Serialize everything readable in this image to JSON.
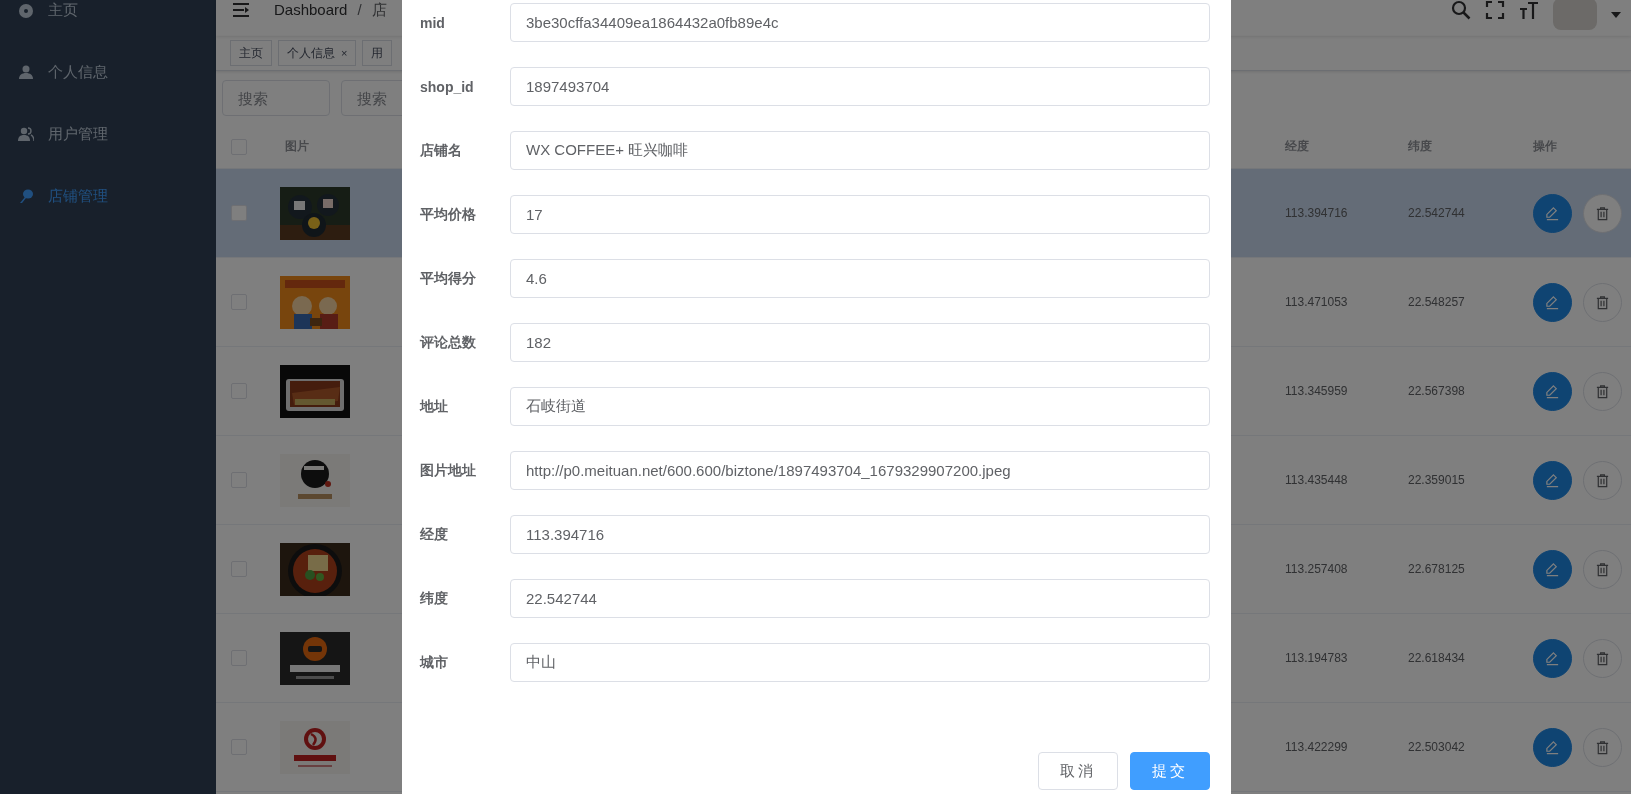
{
  "sidebar": {
    "items": [
      {
        "label": "主页",
        "selected": false
      },
      {
        "label": "个人信息",
        "selected": false
      },
      {
        "label": "用户管理",
        "selected": false
      },
      {
        "label": "店铺管理",
        "selected": true
      }
    ]
  },
  "navbar": {
    "breadcrumb": [
      "Dashboard",
      "/",
      "店"
    ]
  },
  "tags": [
    {
      "label": "主页"
    },
    {
      "label": "个人信息",
      "close": "×"
    },
    {
      "label": "用"
    }
  ],
  "search": [
    {
      "placeholder": "搜索"
    },
    {
      "placeholder": "搜索"
    }
  ],
  "table": {
    "all_checked": false,
    "columns": [
      "图片",
      "经度",
      "纬度",
      "操作"
    ],
    "rows": [
      {
        "selected": true,
        "checked": false,
        "longitude": "113.394716",
        "latitude": "22.542744"
      },
      {
        "selected": false,
        "checked": false,
        "longitude": "113.471053",
        "latitude": "22.548257"
      },
      {
        "selected": false,
        "checked": false,
        "longitude": "113.345959",
        "latitude": "22.567398"
      },
      {
        "selected": false,
        "checked": false,
        "longitude": "113.435448",
        "latitude": "22.359015"
      },
      {
        "selected": false,
        "checked": false,
        "longitude": "113.257408",
        "latitude": "22.678125"
      },
      {
        "selected": false,
        "checked": false,
        "longitude": "113.194783",
        "latitude": "22.618434"
      },
      {
        "selected": false,
        "checked": false,
        "longitude": "113.422299",
        "latitude": "22.503042"
      }
    ]
  },
  "dialog": {
    "fields": [
      {
        "label": "mid",
        "value": "3be30cffa34409ea1864432a0fb89e4c"
      },
      {
        "label": "shop_id",
        "value": "1897493704"
      },
      {
        "label": "店铺名",
        "value": "WX COFFEE+ 旺兴咖啡"
      },
      {
        "label": "平均价格",
        "value": "17"
      },
      {
        "label": "平均得分",
        "value": "4.6"
      },
      {
        "label": "评论总数",
        "value": "182"
      },
      {
        "label": "地址",
        "value": "石岐街道"
      },
      {
        "label": "图片地址",
        "value": "http://p0.meituan.net/600.600/biztone/1897493704_1679329907200.jpeg"
      },
      {
        "label": "经度",
        "value": "113.394716"
      },
      {
        "label": "纬度",
        "value": "22.542744"
      },
      {
        "label": "城市",
        "value": "中山"
      }
    ],
    "buttons": [
      {
        "label": "取消",
        "kind": "default"
      },
      {
        "label": "提交",
        "kind": "primary"
      }
    ]
  }
}
